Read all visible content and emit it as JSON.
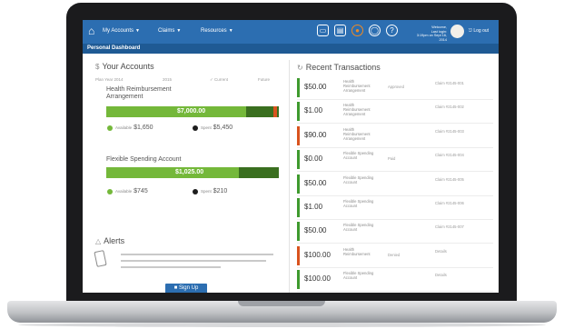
{
  "header": {
    "nav": [
      {
        "label": "My Accounts"
      },
      {
        "label": "Claims"
      },
      {
        "label": "Resources"
      }
    ],
    "user_lines": [
      "Welcome,",
      "Last login:",
      "3:19pm on Sept 16, 2014"
    ],
    "logout_label": "Log out"
  },
  "page_title": "Personal Dashboard",
  "accounts": {
    "title": "Your Accounts",
    "filters": [
      "Plan Year 2014",
      "2015",
      "Current",
      "Future"
    ],
    "items": [
      {
        "name": "Health Reimbursement Arrangement",
        "bar_value": "$7,000.00",
        "fill_fraction": 0.81,
        "available_label": "Available",
        "available_value": "$1,650",
        "spent_label": "Spent",
        "spent_value": "$5,450"
      },
      {
        "name": "Flexible Spending Account",
        "bar_value": "$1,025.00",
        "fill_fraction": 0.77,
        "available_label": "Available",
        "available_value": "$745",
        "spent_label": "Spent",
        "spent_value": "$210"
      }
    ]
  },
  "alerts": {
    "title": "Alerts",
    "signup_label": "Sign Up"
  },
  "transactions": {
    "title": "Recent Transactions",
    "rows": [
      {
        "amount": "$50.00",
        "desc": "Health Reimbursement Arrangement",
        "status": "Approved",
        "claim": "Claim #2145-001",
        "color": "#3f9a2e"
      },
      {
        "amount": "$1.00",
        "desc": "Health Reimbursement Arrangement",
        "status": "",
        "claim": "Claim #2145-002",
        "color": "#3f9a2e"
      },
      {
        "amount": "$90.00",
        "desc": "Health Reimbursement Arrangement",
        "status": "",
        "claim": "Claim #2145-003",
        "color": "#d9531e"
      },
      {
        "amount": "$0.00",
        "desc": "Flexible Spending Account",
        "status": "Paid",
        "claim": "Claim #2145-004",
        "color": "#3f9a2e"
      },
      {
        "amount": "$50.00",
        "desc": "Flexible Spending Account",
        "status": "",
        "claim": "Claim #2145-005",
        "color": "#3f9a2e"
      },
      {
        "amount": "$1.00",
        "desc": "Flexible Spending Account",
        "status": "",
        "claim": "Claim #2145-006",
        "color": "#3f9a2e"
      },
      {
        "amount": "$50.00",
        "desc": "Flexible Spending Account",
        "status": "",
        "claim": "Claim #2145-007",
        "color": "#3f9a2e"
      },
      {
        "amount": "$100.00",
        "desc": "Health Reimbursement",
        "status": "Denied",
        "claim": "Details",
        "color": "#d9531e"
      },
      {
        "amount": "$100.00",
        "desc": "Flexible Spending Account",
        "status": "",
        "claim": "Details",
        "color": "#3f9a2e"
      }
    ]
  },
  "colors": {
    "brand_blue": "#2c6eb1",
    "subbar_blue": "#1f5a94",
    "bar_green": "#74b83a",
    "bar_dark_green": "#3a6f1f",
    "alert_orange": "#d9531e"
  }
}
